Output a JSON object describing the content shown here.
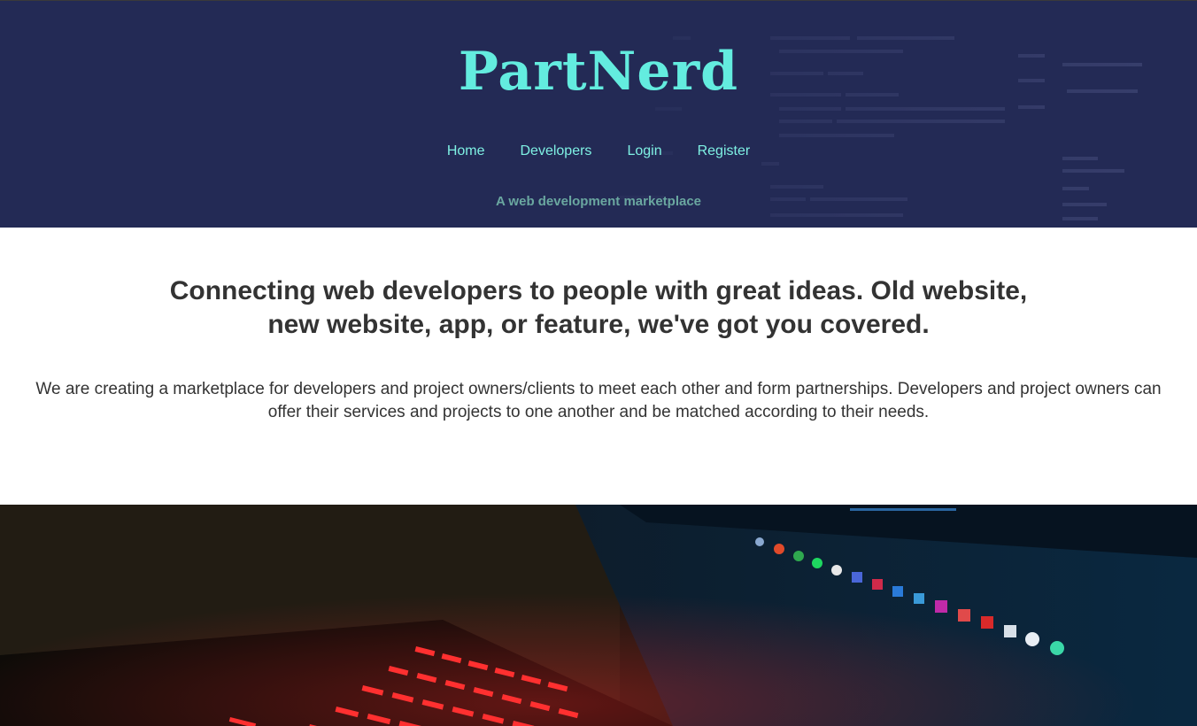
{
  "header": {
    "brand": "PartNerd",
    "tagline": "A web development marketplace",
    "nav": [
      {
        "label": "Home"
      },
      {
        "label": "Developers"
      },
      {
        "label": "Login"
      },
      {
        "label": "Register"
      }
    ]
  },
  "intro": {
    "headline": "Connecting web developers to people with great ideas. Old website, new website, app, or feature, we've got you covered.",
    "description": "We are creating a marketplace for developers and project owners/clients to meet each other and form partnerships. Developers and project owners can offer their services and projects to one another and be matched according to their needs."
  },
  "colors": {
    "header_bg": "#232a55",
    "brand": "#63ecdf",
    "nav_link": "#7ef0e3",
    "tagline": "#6aa7a0",
    "text": "#333333",
    "keyboard_glow": "#ff2a2a"
  }
}
